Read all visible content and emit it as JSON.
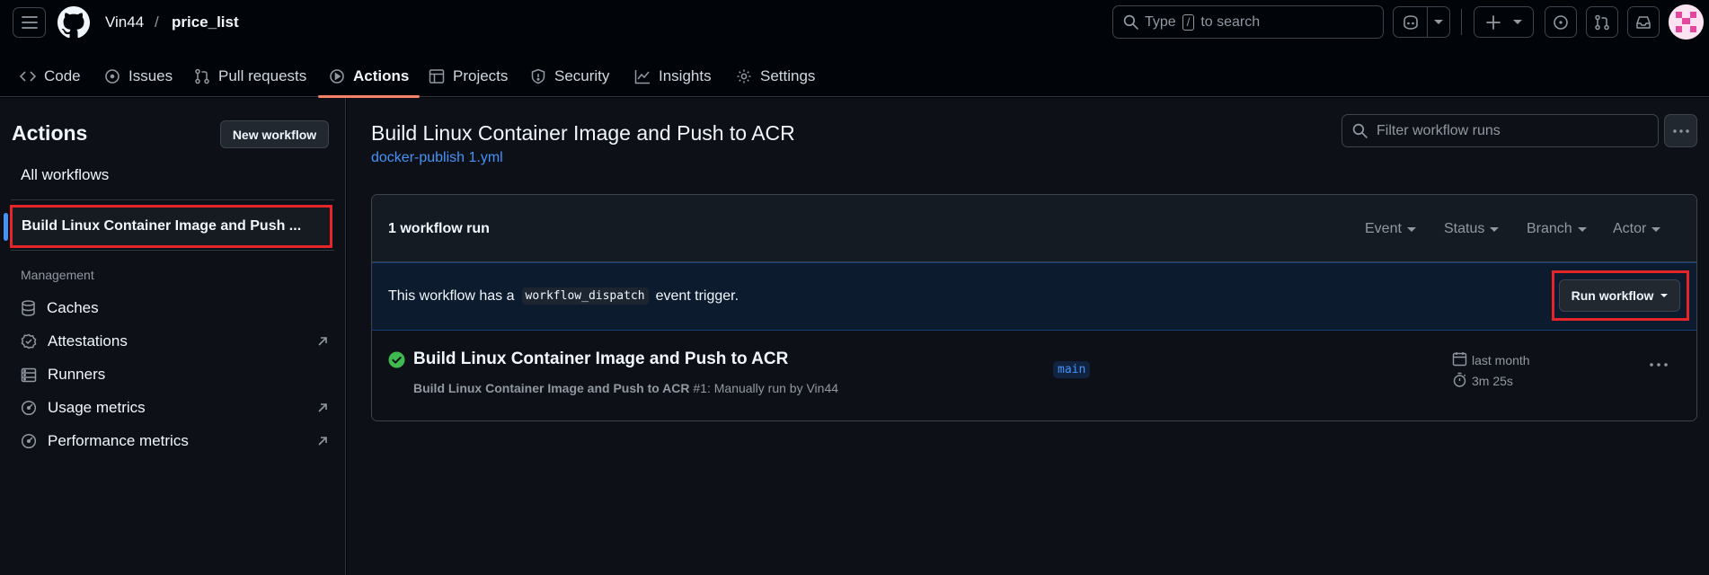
{
  "header": {
    "owner": "Vin44",
    "separator": "/",
    "repo": "price_list",
    "search_prefix": "Type",
    "search_key": "/",
    "search_suffix": "to search"
  },
  "repo_nav": {
    "tabs": [
      {
        "label": "Code",
        "icon": "code-icon"
      },
      {
        "label": "Issues",
        "icon": "issue-icon"
      },
      {
        "label": "Pull requests",
        "icon": "pull-request-icon"
      },
      {
        "label": "Actions",
        "icon": "play-icon",
        "active": true
      },
      {
        "label": "Projects",
        "icon": "table-icon"
      },
      {
        "label": "Security",
        "icon": "shield-icon"
      },
      {
        "label": "Insights",
        "icon": "graph-icon"
      },
      {
        "label": "Settings",
        "icon": "gear-icon"
      }
    ]
  },
  "sidebar": {
    "title": "Actions",
    "new_workflow": "New workflow",
    "all_workflows": "All workflows",
    "selected_workflow": "Build Linux Container Image and Push ...",
    "management_heading": "Management",
    "management_items": [
      {
        "label": "Caches",
        "icon": "database-icon"
      },
      {
        "label": "Attestations",
        "icon": "verified-icon"
      },
      {
        "label": "Runners",
        "icon": "server-icon"
      },
      {
        "label": "Usage metrics",
        "icon": "meter-icon"
      },
      {
        "label": "Performance metrics",
        "icon": "meter-icon"
      }
    ]
  },
  "main": {
    "title": "Build Linux Container Image and Push to ACR",
    "file_link": "docker-publish 1.yml",
    "filter_placeholder": "Filter workflow runs",
    "runs_count": "1 workflow run",
    "filters": [
      "Event",
      "Status",
      "Branch",
      "Actor"
    ],
    "dispatch_prefix": "This workflow has a",
    "dispatch_code": "workflow_dispatch",
    "dispatch_suffix": "event trigger.",
    "run_workflow": "Run workflow",
    "run": {
      "title": "Build Linux Container Image and Push to ACR",
      "subtitle_bold": "Build Linux Container Image and Push to ACR",
      "subtitle_rest": "#1: Manually run by Vin44",
      "branch": "main",
      "when": "last month",
      "duration": "3m 25s",
      "status": "success"
    }
  },
  "colors": {
    "accent_link": "#4493f8",
    "highlight_box": "#e5252a",
    "success": "#3fb950",
    "active_underline": "#f78166"
  }
}
